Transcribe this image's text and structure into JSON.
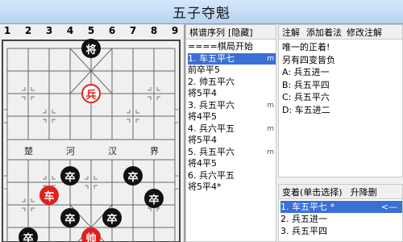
{
  "window": {
    "title": "五子夺魁"
  },
  "board": {
    "col_numbers": [
      "1",
      "2",
      "3",
      "4",
      "5",
      "6",
      "7",
      "8",
      "9"
    ],
    "river": [
      "楚",
      "河",
      "汉",
      "界"
    ],
    "pieces": {
      "top_jiang": "将",
      "red_bing": "兵",
      "black_zu_1": "卒",
      "black_zu_2": "卒",
      "black_zu_3": "卒",
      "black_zu_4": "卒",
      "red_che": "车",
      "black_zu_5": "卒",
      "black_zu_6": "卒",
      "black_zu_7": "卒",
      "red_shuai": "帅"
    }
  },
  "movelist": {
    "tab": "棋谱序列",
    "hide_label": "[隐藏]",
    "lines": [
      {
        "text": "====棋局开始",
        "mark": ""
      },
      {
        "text": " 1. 车五平七",
        "mark": "m",
        "selected": true
      },
      {
        "text": "    前卒平5",
        "mark": ""
      },
      {
        "text": " 2. 帅五平六",
        "mark": ""
      },
      {
        "text": "    将5平4",
        "mark": ""
      },
      {
        "text": " 3. 兵五平六",
        "mark": "m"
      },
      {
        "text": "    将4平5",
        "mark": ""
      },
      {
        "text": " 4. 兵六平五",
        "mark": "m"
      },
      {
        "text": "    将5平4",
        "mark": ""
      },
      {
        "text": " 5. 兵五平六",
        "mark": "m"
      },
      {
        "text": "    将4平5",
        "mark": ""
      },
      {
        "text": " 6. 兵六平五",
        "mark": ""
      },
      {
        "text": "    将5平4*",
        "mark": ""
      }
    ]
  },
  "comment": {
    "tabs": [
      "注解",
      "添加着法",
      "修改注解"
    ],
    "lines": [
      "唯一的正着!",
      "另有四变皆负",
      "A: 兵五进一",
      "B: 兵五平四",
      "C: 兵五平六",
      "D: 车五进二"
    ]
  },
  "variation": {
    "tab": "变着(单击选择)",
    "action": "升降删",
    "lines": [
      {
        "text": " 1. 车五平七 *",
        "arrow": "<—",
        "selected": true
      },
      {
        "text": " 2. 兵五进一",
        "arrow": ""
      },
      {
        "text": " 3. 兵五平四",
        "arrow": ""
      }
    ]
  }
}
